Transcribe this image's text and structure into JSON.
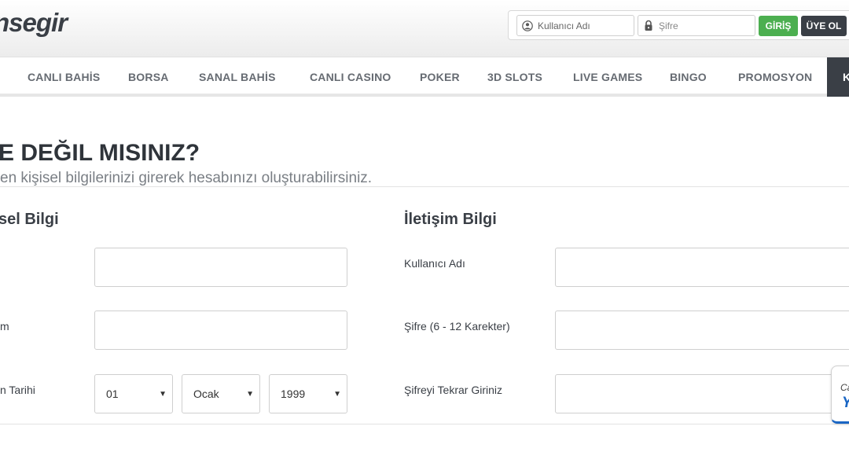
{
  "header": {
    "logo_text": "nsegir",
    "login": {
      "username_placeholder": "Kullanıcı Adı",
      "password_placeholder": "Şifre",
      "login_button": "GİRİŞ",
      "register_button": "ÜYE OL"
    }
  },
  "nav": {
    "items": [
      {
        "label": "CANLI BAHİS"
      },
      {
        "label": "BORSA"
      },
      {
        "label": "SANAL BAHİS"
      },
      {
        "label": "CANLI CASINO"
      },
      {
        "label": "POKER"
      },
      {
        "label": "3D SLOTS"
      },
      {
        "label": "LIVE GAMES"
      },
      {
        "label": "BINGO"
      },
      {
        "label": "PROMOSYON"
      }
    ],
    "dark_item_label": "K"
  },
  "main": {
    "title": "E DEĞIL MISINIZ?",
    "subtitle": "en kişisel bilgilerinizi girerek hesabınızı oluşturabilirsiniz.",
    "personal": {
      "title": "sel Bilgi",
      "field2_label": "m",
      "field3_label": "n Tarihi",
      "birth_day": "01",
      "birth_month": "Ocak",
      "birth_year": "1999"
    },
    "contact": {
      "title": "İletişim Bilgi",
      "username_label": "Kullanıcı Adı",
      "password_label": "Şifre (6 - 12 Karekter)",
      "password_repeat_label": "Şifreyi Tekrar Giriniz"
    }
  },
  "chat_widget": {
    "line1": "Ca",
    "line2": "Y"
  },
  "colors": {
    "dark": "#3a3f46",
    "green": "#4caf50",
    "blue": "#1a66c4"
  }
}
